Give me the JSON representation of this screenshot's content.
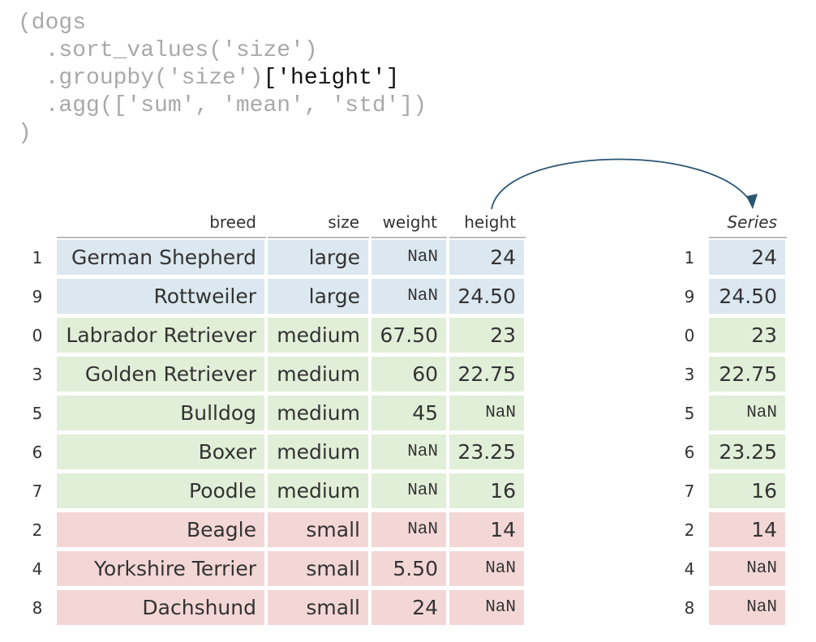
{
  "code": {
    "line1": "(dogs",
    "line2": "  .sort_values('size')",
    "line3_pre": "  .groupby('size')",
    "line3_hl": "['height']",
    "line4": "  .agg(['sum', 'mean', 'std'])",
    "line5": ")"
  },
  "left_table": {
    "headers": [
      "breed",
      "size",
      "weight",
      "height"
    ],
    "rows": [
      {
        "index": "1",
        "group": "large",
        "breed": "German Shepherd",
        "size": "large",
        "weight": "NaN",
        "height": "24"
      },
      {
        "index": "9",
        "group": "large",
        "breed": "Rottweiler",
        "size": "large",
        "weight": "NaN",
        "height": "24.50"
      },
      {
        "index": "0",
        "group": "medium",
        "breed": "Labrador Retriever",
        "size": "medium",
        "weight": "67.50",
        "height": "23"
      },
      {
        "index": "3",
        "group": "medium",
        "breed": "Golden Retriever",
        "size": "medium",
        "weight": "60",
        "height": "22.75"
      },
      {
        "index": "5",
        "group": "medium",
        "breed": "Bulldog",
        "size": "medium",
        "weight": "45",
        "height": "NaN"
      },
      {
        "index": "6",
        "group": "medium",
        "breed": "Boxer",
        "size": "medium",
        "weight": "NaN",
        "height": "23.25"
      },
      {
        "index": "7",
        "group": "medium",
        "breed": "Poodle",
        "size": "medium",
        "weight": "NaN",
        "height": "16"
      },
      {
        "index": "2",
        "group": "small",
        "breed": "Beagle",
        "size": "small",
        "weight": "NaN",
        "height": "14"
      },
      {
        "index": "4",
        "group": "small",
        "breed": "Yorkshire Terrier",
        "size": "small",
        "weight": "5.50",
        "height": "NaN"
      },
      {
        "index": "8",
        "group": "small",
        "breed": "Dachshund",
        "size": "small",
        "weight": "24",
        "height": "NaN"
      }
    ]
  },
  "right_table": {
    "header": "Series",
    "rows": [
      {
        "index": "1",
        "group": "large",
        "value": "24"
      },
      {
        "index": "9",
        "group": "large",
        "value": "24.50"
      },
      {
        "index": "0",
        "group": "medium",
        "value": "23"
      },
      {
        "index": "3",
        "group": "medium",
        "value": "22.75"
      },
      {
        "index": "5",
        "group": "medium",
        "value": "NaN"
      },
      {
        "index": "6",
        "group": "medium",
        "value": "23.25"
      },
      {
        "index": "7",
        "group": "medium",
        "value": "16"
      },
      {
        "index": "2",
        "group": "small",
        "value": "14"
      },
      {
        "index": "4",
        "group": "small",
        "value": "NaN"
      },
      {
        "index": "8",
        "group": "small",
        "value": "NaN"
      }
    ]
  },
  "colors": {
    "large": "#dce8f0",
    "medium": "#e2efd8",
    "small": "#f3d7d6",
    "arrow": "#2c5574"
  }
}
